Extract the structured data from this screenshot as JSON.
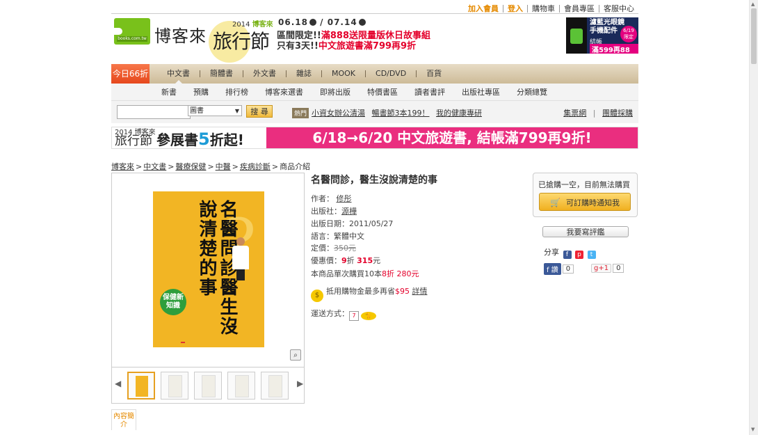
{
  "toplinks": [
    "加入會員",
    "登入",
    "購物車",
    "會員專區",
    "客服中心"
  ],
  "logo": {
    "small": "books.com.tw",
    "name": "博客來"
  },
  "fest": {
    "year": "2014",
    "brand": "博客來",
    "name": "旅行節"
  },
  "dates": {
    "start": "06.18",
    "end": "07.14"
  },
  "promo": {
    "line1_prefix": "區間限定!!",
    "line1_red": "滿888送限量版休日故事組",
    "line2_prefix": "只有3天!!",
    "line2_red": "中文旅遊書滿799再9折"
  },
  "ad_right": {
    "line1": "濾藍光眼鏡",
    "line2": "手機配件",
    "badge": "6/19 限定",
    "line3": "結帳",
    "line4": "滿599再88折"
  },
  "nav": {
    "today": "今日66折",
    "main": [
      "中文書",
      "簡體書",
      "外文書",
      "雜誌",
      "MOOK",
      "CD/DVD",
      "百貨"
    ],
    "sub": [
      "新書",
      "預購",
      "排行榜",
      "博客來選書",
      "即將出版",
      "特價書區",
      "讀者書評",
      "出版社專區",
      "分類總覽"
    ]
  },
  "search": {
    "value": "",
    "category": "圖書",
    "button": "搜 尋",
    "hot_label": "熱門",
    "hot_links": [
      "小資女辦公清湯",
      "暢書節3本199！",
      "我的健康專研"
    ],
    "right_links": [
      "集票網",
      "團體採購"
    ]
  },
  "banner": {
    "left_prefix": "參展書",
    "left_num": "5",
    "left_suffix": "折起!",
    "right": "6/18→6/20 中文旅遊書, 結帳滿799再9折!"
  },
  "breadcrumb": [
    "博客來",
    "中文書",
    "醫療保健",
    "中醫",
    "疾病診斷",
    "商品介紹"
  ],
  "book": {
    "title": "名醫問診，醫生沒說清楚的事",
    "cover_title": "名醫問診醫生沒說清楚的事",
    "cover_badge": "保健新知識",
    "author_label": "作者：",
    "author": "修彤",
    "publisher_label": "出版社：",
    "publisher": "源樺",
    "date_label": "出版日期：",
    "date": "2011/05/27",
    "lang_label": "語言：",
    "lang": "繁體中文",
    "price_label": "定價：",
    "price": "350元",
    "sale_label": "優惠價：",
    "sale_discount": "9",
    "sale_unit": "折",
    "sale_price": "315",
    "sale_suffix": "元",
    "bulk_prefix": "本商品單次購買10本",
    "bulk_discount": "8折",
    "bulk_price": "280元",
    "points_prefix": "抵用購物金最多再省",
    "points_amount": "$95",
    "points_link": "詳情",
    "ship_label": "運送方式："
  },
  "buybox": {
    "message": "已搶購一空，目前無法購買",
    "button": "可訂購時通知我"
  },
  "review_button": "我要寫評鑑",
  "share": {
    "label": "分享",
    "fb_like": "讚",
    "fb_count": "0",
    "gplus": "+1",
    "gplus_count": "0"
  },
  "tab_intro": "內容簡介"
}
